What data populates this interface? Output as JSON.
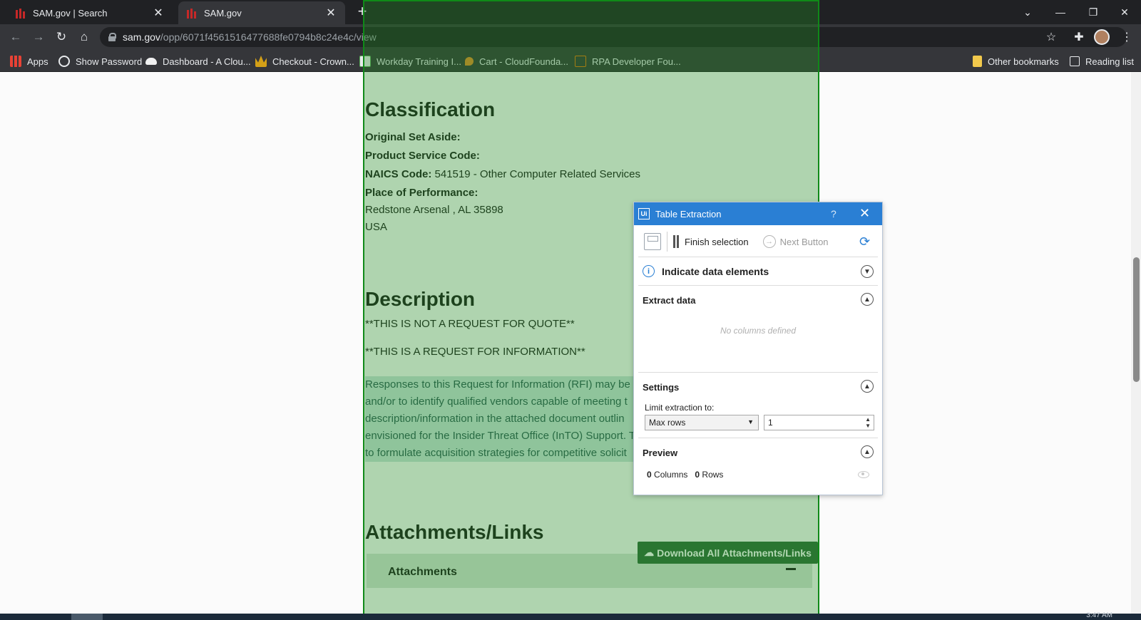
{
  "browser": {
    "tabs": [
      {
        "title": "SAM.gov | Search",
        "active": false
      },
      {
        "title": "SAM.gov",
        "active": true
      }
    ],
    "new_tab": "+",
    "url_host": "sam.gov",
    "url_path": "/opp/6071f4561516477688fe0794b8c24e4c/view",
    "window_controls": [
      "⌄",
      "—",
      "❐",
      "✕"
    ],
    "bookmarks": [
      {
        "label": "Apps",
        "icon": "apps-grid-icon",
        "color": "#e94235"
      },
      {
        "label": "Show Password",
        "icon": "globe-icon",
        "color": "#9aa0a6"
      },
      {
        "label": "Dashboard - A Clou...",
        "icon": "cloud-icon",
        "color": "#f0f0f0"
      },
      {
        "label": "Checkout - Crown...",
        "icon": "crown-icon",
        "color": "#d4a017"
      },
      {
        "label": "Workday Training I...",
        "icon": "workday-icon",
        "color": "#5aa85a"
      },
      {
        "label": "Cart - CloudFounda...",
        "icon": "pin-icon",
        "color": "#e08a2a"
      },
      {
        "label": "RPA Developer Fou...",
        "icon": "uipath-icon",
        "color": "#e8760a"
      }
    ],
    "other_bookmarks": "Other bookmarks",
    "reading_list": "Reading list"
  },
  "page": {
    "classification_title": "Classification",
    "original_set_aside_label": "Original Set Aside:",
    "product_service_code_label": "Product Service Code:",
    "naics_label": "NAICS Code:",
    "naics_value": " 541519 - Other Computer Related Services",
    "place_label": "Place of Performance:",
    "place_line1": "Redstone Arsenal , AL 35898",
    "place_line2": "USA",
    "description_title": "Description",
    "desc_line1": "**THIS IS NOT A REQUEST FOR QUOTE**",
    "desc_line2": "**THIS IS A REQUEST FOR INFORMATION**",
    "desc_para": [
      "Responses to this Request for Information (RFI) may be u",
      "and/or to identify qualified vendors capable of meeting t",
      "description/information in the attached document outlin",
      "envisioned for the Insider Threat Office (InTO) Support. T",
      "to formulate acquisition strategies for competitive solicit"
    ],
    "attachments_title": "Attachments/Links",
    "download_all": "Download All Attachments/Links",
    "attachments_label": "Attachments"
  },
  "table_extraction": {
    "title": "Table Extraction",
    "help": "?",
    "finish_selection": "Finish selection",
    "next_button": "Next Button",
    "indicate": "Indicate data elements",
    "extract_data": "Extract data",
    "no_columns": "No columns defined",
    "settings": "Settings",
    "limit_label": "Limit extraction to:",
    "limit_mode": "Max rows",
    "limit_value": "1",
    "preview": "Preview",
    "columns_count": "0",
    "columns_label": " Columns",
    "rows_count": "0",
    "rows_label": " Rows"
  },
  "taskbar": {
    "clock": "3:47 AM"
  },
  "colors": {
    "overlay": "#0f8a18",
    "panel_header": "#2a7fd4",
    "download_button": "#2f6b3a"
  }
}
